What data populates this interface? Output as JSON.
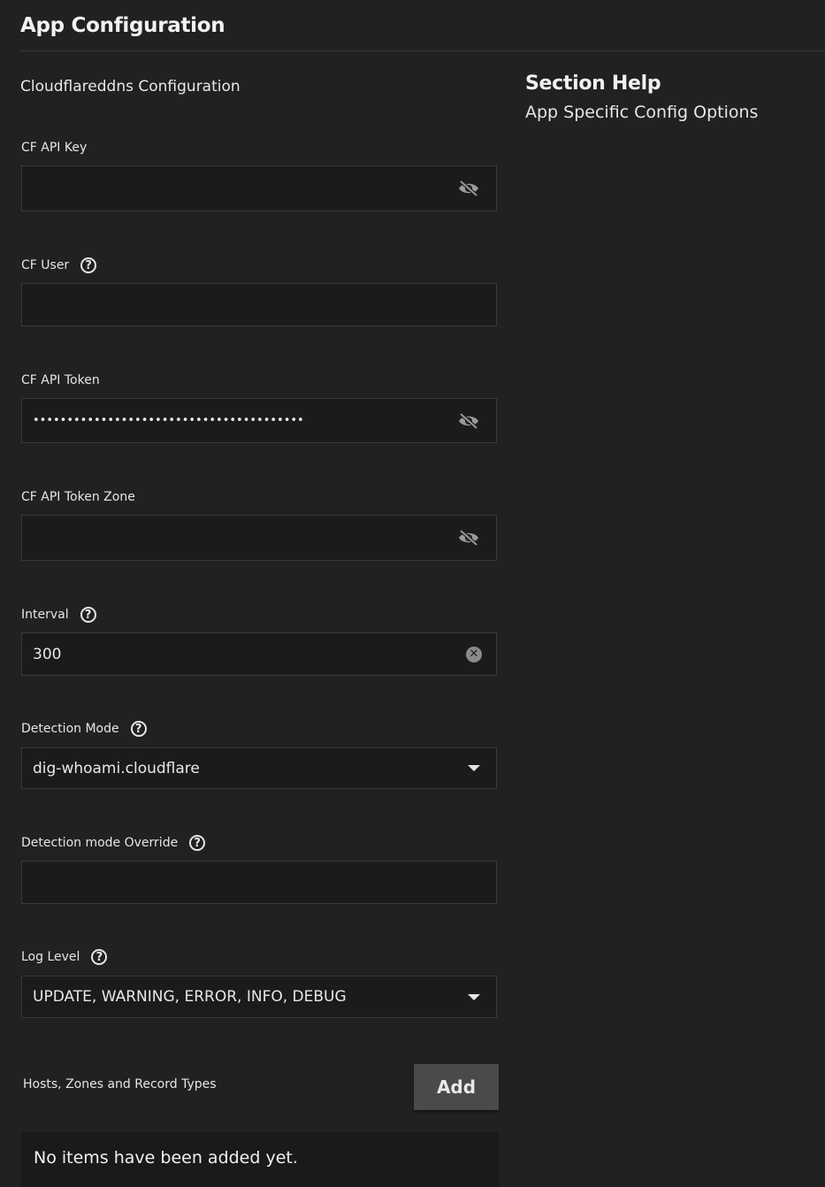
{
  "header": {
    "title": "App Configuration"
  },
  "section": {
    "title": "Cloudflareddns Configuration"
  },
  "help_panel": {
    "title": "Section Help",
    "text": "App Specific Config Options"
  },
  "fields": {
    "cf_api_key": {
      "label": "CF API Key",
      "value": "",
      "icon": "eye-off-icon"
    },
    "cf_user": {
      "label": "CF User",
      "value": "",
      "help_icon": "help-circle-icon"
    },
    "cf_api_token": {
      "label": "CF API Token",
      "value": "••••••••••••••••••••••••••••••••••••••••",
      "icon": "eye-off-icon"
    },
    "cf_api_token_zone": {
      "label": "CF API Token Zone",
      "value": "",
      "icon": "eye-off-icon"
    },
    "interval": {
      "label": "Interval",
      "value": "300",
      "help_icon": "help-circle-icon",
      "icon": "clear-icon"
    },
    "detection_mode": {
      "label": "Detection Mode",
      "value": "dig-whoami.cloudflare",
      "help_icon": "help-circle-icon"
    },
    "detection_mode_override": {
      "label": "Detection mode Override",
      "value": "",
      "help_icon": "help-circle-icon"
    },
    "log_level": {
      "label": "Log Level",
      "value": "UPDATE, WARNING, ERROR, INFO, DEBUG",
      "help_icon": "help-circle-icon"
    }
  },
  "hosts": {
    "label": "Hosts, Zones and Record Types",
    "add_label": "Add",
    "empty_text": "No items have been added yet."
  },
  "colors": {
    "background": "#212121",
    "input_background": "#1b1b1b",
    "input_border": "#3a3a3a",
    "button_background": "#4a4a4a",
    "text": "#e6e6e6"
  }
}
